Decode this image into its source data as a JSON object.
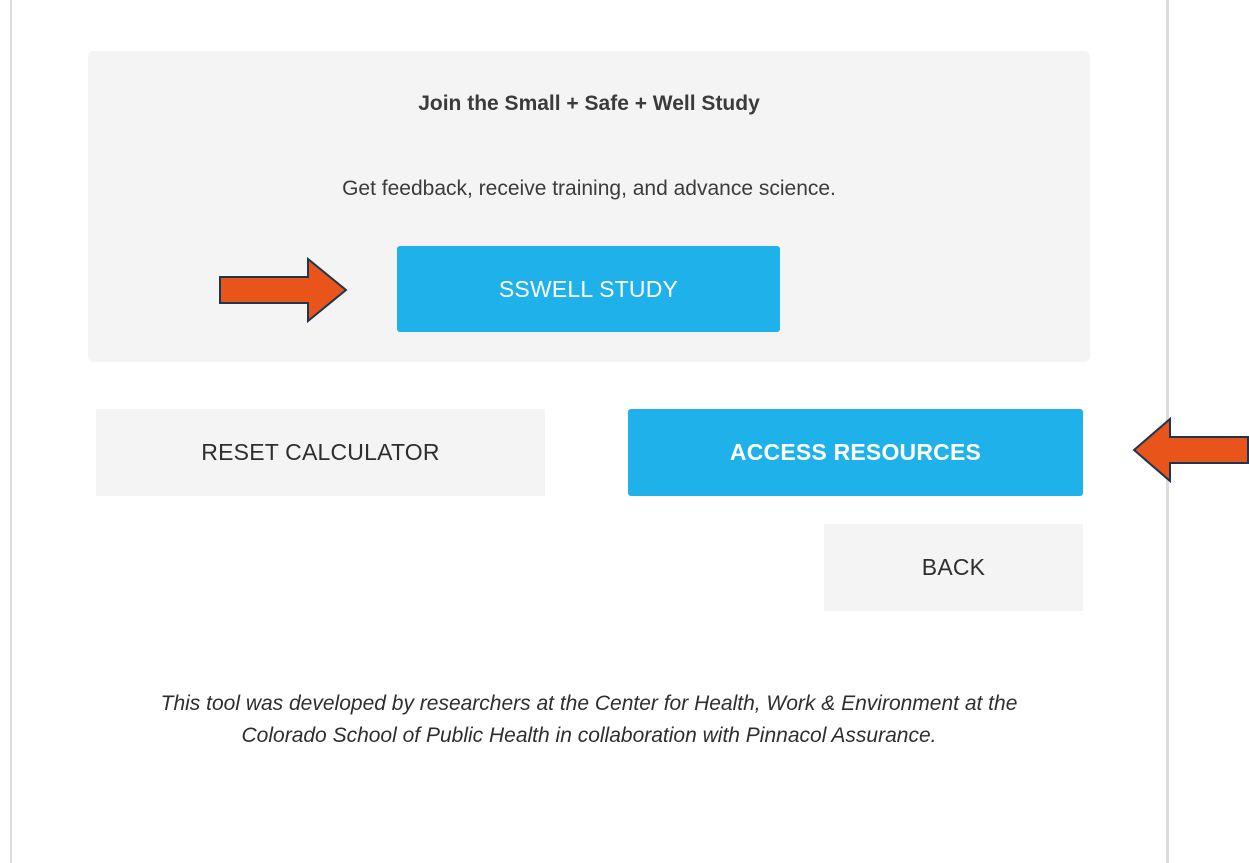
{
  "study": {
    "title": "Join the Small + Safe + Well Study",
    "subtitle": "Get feedback, receive training, and advance science.",
    "button_label": "SSWELL STUDY"
  },
  "actions": {
    "reset_label": "RESET CALCULATOR",
    "access_label": "ACCESS RESOURCES",
    "back_label": "BACK"
  },
  "footer": {
    "note": "This tool was developed by researchers at the Center for Health, Work & Environment at the Colorado School of Public Health in collaboration with Pinnacol Assurance."
  },
  "colors": {
    "primary_button": "#1fb1ea",
    "secondary_button": "#f4f4f4",
    "card_background": "#f4f4f4",
    "annotation_arrow": "#e8541a",
    "annotation_arrow_outline": "#1e3550"
  },
  "icons": {
    "study_arrow": "right-arrow-icon",
    "resources_arrow": "left-arrow-icon"
  }
}
